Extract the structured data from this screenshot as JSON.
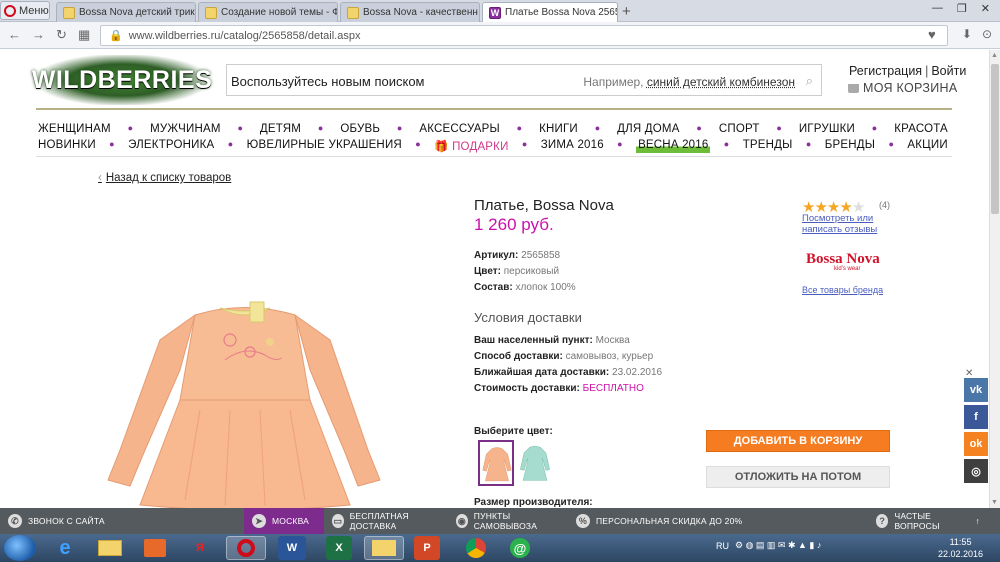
{
  "browser": {
    "menu_label": "Меню",
    "tabs": [
      {
        "label": "Bossa Nova детский трик"
      },
      {
        "label": "Создание новой темы - Ф"
      },
      {
        "label": "Bossa Nova - качественн"
      },
      {
        "label": "Платье Bossa Nova 25658"
      }
    ],
    "url": "www.wildberries.ru/catalog/2565858/detail.aspx"
  },
  "header": {
    "logo": "WILDBERRIES",
    "search_placeholder": "Воспользуйтесь новым поиском",
    "search_hint_prefix": "Например, ",
    "search_hint_link": "синий детский комбинезон",
    "register": "Регистрация",
    "login": "Войти",
    "cart": "МОЯ КОРЗИНА"
  },
  "nav": {
    "row1": [
      "ЖЕНЩИНАМ",
      "МУЖЧИНАМ",
      "ДЕТЯМ",
      "ОБУВЬ",
      "АКСЕССУАРЫ",
      "КНИГИ",
      "ДЛЯ ДОМА",
      "СПОРТ",
      "ИГРУШКИ",
      "КРАСОТА"
    ],
    "row2": [
      "НОВИНКИ",
      "ЭЛЕКТРОНИКА",
      "ЮВЕЛИРНЫЕ УКРАШЕНИЯ",
      "ПОДАРКИ",
      "ЗИМА 2016",
      "ВЕСНА 2016",
      "ТРЕНДЫ",
      "БРЕНДЫ",
      "АКЦИИ"
    ]
  },
  "product": {
    "back": "Назад к списку товаров",
    "title": "Платье, Bossa Nova",
    "price": "1 260 руб.",
    "article_label": "Артикул:",
    "article": "2565858",
    "color_label": "Цвет:",
    "color": "персиковый",
    "composition_label": "Состав:",
    "composition": "хлопок 100%",
    "delivery_title": "Условия доставки",
    "city_label": "Ваш населенный пункт:",
    "city": "Москва",
    "method_label": "Способ доставки:",
    "method": "самовывоз, курьер",
    "date_label": "Ближайшая дата доставки:",
    "date": "23.02.2016",
    "cost_label": "Стоимость доставки:",
    "cost": "БЕСПЛАТНО",
    "choose_color": "Выберите цвет:",
    "size_label": "Размер производителя:",
    "rating_count": "(4)",
    "rating": 4,
    "rating_max": 5,
    "reviews_link": "Посмотреть или написать отзывы",
    "brand_logo": "Bossa Nova",
    "brand_sub": "kid's wear",
    "brand_link": "Все товары бренда",
    "add_to_cart": "ДОБАВИТЬ В КОРЗИНУ",
    "save_later": "ОТЛОЖИТЬ НА ПОТОМ"
  },
  "footer": {
    "items": [
      "ЗВОНОК С САЙТА",
      "МОСКВА",
      "БЕСПЛАТНАЯ ДОСТАВКА",
      "ПУНКТЫ САМОВЫВОЗА",
      "ПЕРСОНАЛЬНАЯ СКИДКА ДО 20%",
      "ЧАСТЫЕ ВОПРОСЫ"
    ]
  },
  "taskbar": {
    "lang": "RU",
    "time": "11:55",
    "date": "22.02.2016"
  },
  "colors": {
    "accent": "#cb11ab",
    "brand_purple": "#7d2c8d",
    "button_orange": "#f57c20"
  }
}
